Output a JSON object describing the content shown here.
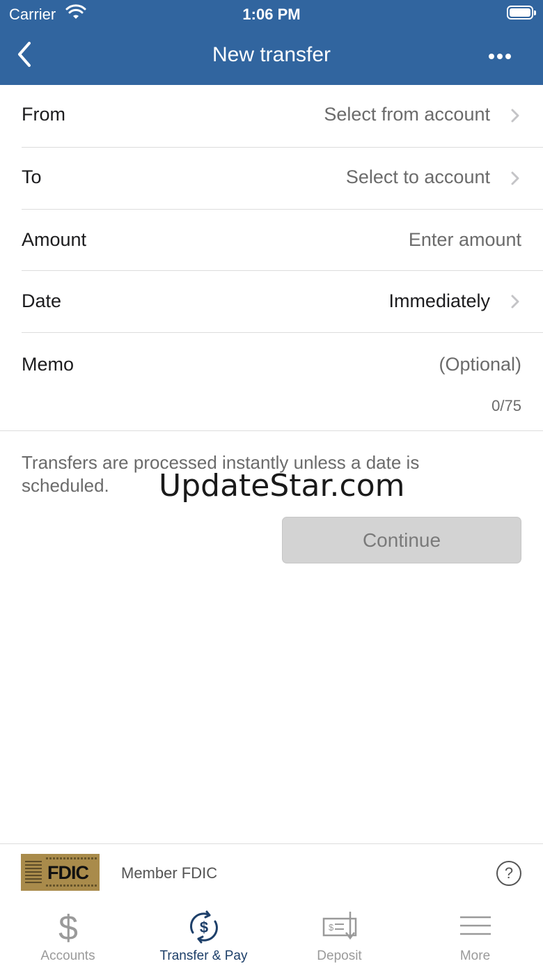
{
  "status_bar": {
    "carrier": "Carrier",
    "time": "1:06 PM"
  },
  "nav": {
    "title": "New transfer",
    "back_icon": "chevron-left-icon",
    "more_icon": "ellipsis-icon"
  },
  "form": {
    "from": {
      "label": "From",
      "value": "Select from account"
    },
    "to": {
      "label": "To",
      "value": "Select to account"
    },
    "amount": {
      "label": "Amount",
      "placeholder": "Enter amount"
    },
    "date": {
      "label": "Date",
      "value": "Immediately"
    },
    "memo": {
      "label": "Memo",
      "placeholder": "(Optional)",
      "counter": "0/75"
    }
  },
  "info_text": "Transfers are processed instantly unless a date is scheduled.",
  "watermark": "UpdateStar.com",
  "continue_label": "Continue",
  "footer": {
    "fdic_logo_text": "FDIC",
    "member_text": "Member FDIC",
    "help_label": "?"
  },
  "tabs": [
    {
      "label": "Accounts",
      "icon": "dollar-icon",
      "active": false
    },
    {
      "label": "Transfer & Pay",
      "icon": "transfer-cycle-dollar-icon",
      "active": true
    },
    {
      "label": "Deposit",
      "icon": "check-deposit-icon",
      "active": false
    },
    {
      "label": "More",
      "icon": "hamburger-menu-icon",
      "active": false
    }
  ],
  "colors": {
    "header": "#31659f",
    "active_tab": "#1d3f69",
    "inactive_tab": "#9a9a9a",
    "button_disabled": "#d3d3d3"
  }
}
